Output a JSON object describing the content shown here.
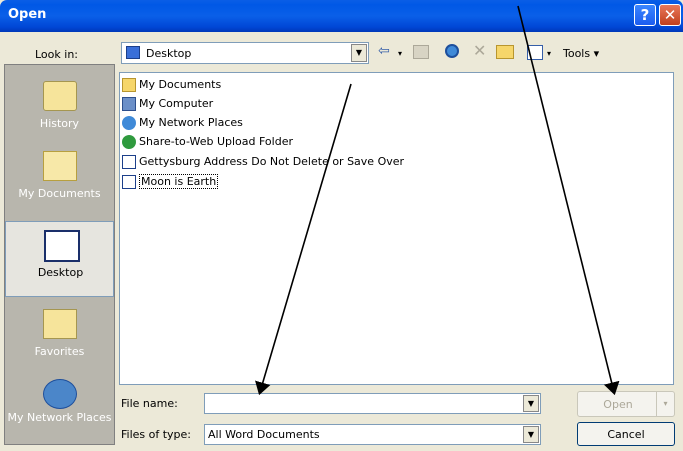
{
  "window": {
    "title": "Open",
    "help_glyph": "?",
    "close_glyph": "✕"
  },
  "lookin": {
    "label": "Look in:",
    "value": "Desktop"
  },
  "toolbar": {
    "back_glyph": "⇦",
    "tools_label": "Tools"
  },
  "places": [
    {
      "label": "History",
      "icon": "history-icon"
    },
    {
      "label": "My Documents",
      "icon": "my-documents-icon"
    },
    {
      "label": "Desktop",
      "icon": "desktop-icon",
      "selected": true
    },
    {
      "label": "Favorites",
      "icon": "favorites-icon"
    },
    {
      "label": "My Network Places",
      "icon": "network-places-icon"
    }
  ],
  "files": [
    {
      "name": "My Documents",
      "icon": "folder-documents-icon"
    },
    {
      "name": "My Computer",
      "icon": "computer-icon"
    },
    {
      "name": "My Network Places",
      "icon": "network-icon"
    },
    {
      "name": "Share-to-Web Upload Folder",
      "icon": "web-folder-icon"
    },
    {
      "name": "Gettysburg Address Do Not Delete or Save Over",
      "icon": "word-doc-icon"
    },
    {
      "name": "Moon is Earth",
      "icon": "word-doc-icon"
    }
  ],
  "filename": {
    "label": "File name:",
    "value": ""
  },
  "filetype": {
    "label": "Files of type:",
    "value": "All Word Documents"
  },
  "buttons": {
    "open": "Open",
    "cancel": "Cancel"
  }
}
